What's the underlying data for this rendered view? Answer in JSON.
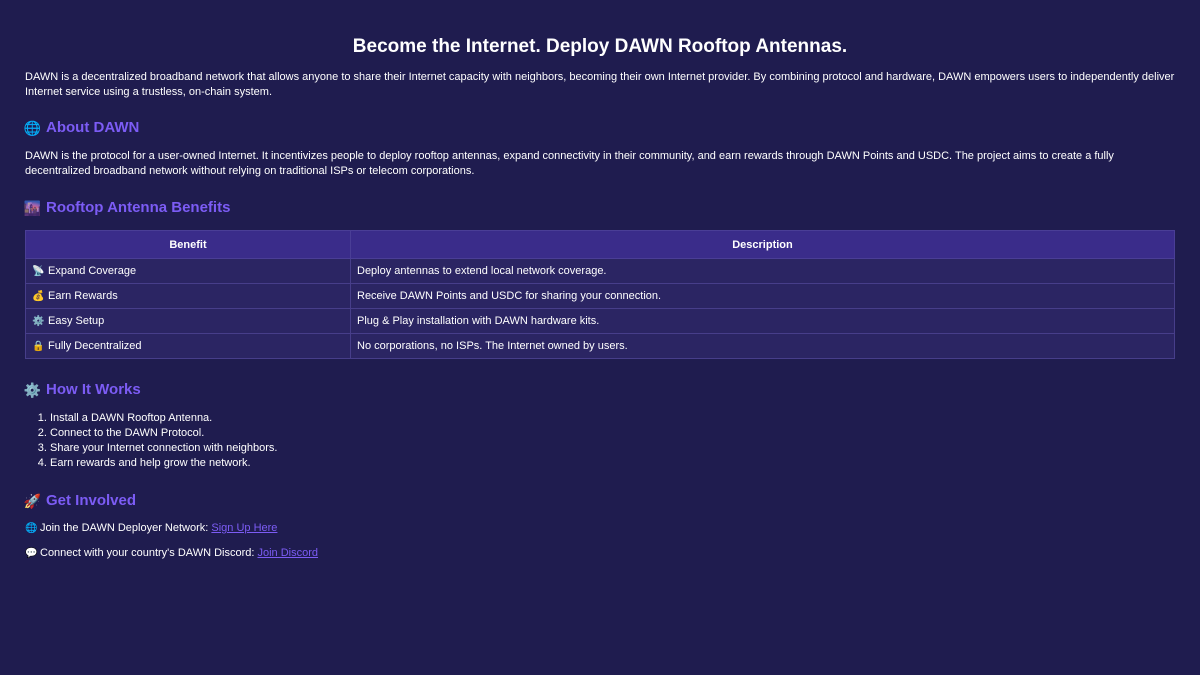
{
  "header": {
    "title": "Become the Internet. Deploy DAWN Rooftop Antennas.",
    "intro": "DAWN is a decentralized broadband network that allows anyone to share their Internet capacity with neighbors, becoming their own Internet provider. By combining protocol and hardware, DAWN empowers users to independently deliver Internet service using a trustless, on-chain system."
  },
  "about": {
    "icon": "🌐",
    "icon_name": "globe-icon",
    "heading": "About DAWN",
    "text": "DAWN is the protocol for a user-owned Internet. It incentivizes people to deploy rooftop antennas, expand connectivity in their community, and earn rewards through DAWN Points and USDC. The project aims to create a fully decentralized broadband network without relying on traditional ISPs or telecom corporations."
  },
  "benefits": {
    "icon": "🌆",
    "icon_name": "cityscape-icon",
    "heading": "Rooftop Antenna Benefits",
    "columns": [
      "Benefit",
      "Description"
    ],
    "rows": [
      {
        "icon": "📡",
        "icon_name": "satellite-antenna-icon",
        "benefit": "Expand Coverage",
        "description": "Deploy antennas to extend local network coverage."
      },
      {
        "icon": "💰",
        "icon_name": "money-bag-icon",
        "benefit": "Earn Rewards",
        "description": "Receive DAWN Points and USDC for sharing your connection."
      },
      {
        "icon": "⚙️",
        "icon_name": "gear-icon",
        "benefit": "Easy Setup",
        "description": "Plug & Play installation with DAWN hardware kits."
      },
      {
        "icon": "🔒",
        "icon_name": "lock-icon",
        "benefit": "Fully Decentralized",
        "description": "No corporations, no ISPs. The Internet owned by users."
      }
    ]
  },
  "how": {
    "icon": "⚙️",
    "icon_name": "gear-icon",
    "heading": "How It Works",
    "steps": [
      "Install a DAWN Rooftop Antenna.",
      "Connect to the DAWN Protocol.",
      "Share your Internet connection with neighbors.",
      "Earn rewards and help grow the network."
    ]
  },
  "involved": {
    "icon": "🚀",
    "icon_name": "rocket-icon",
    "heading": "Get Involved",
    "deployer": {
      "icon": "🌐",
      "text": "Join the DAWN Deployer Network: ",
      "link": "Sign Up Here"
    },
    "discord": {
      "icon": "💬",
      "text": "Connect with your country's DAWN Discord: ",
      "link": "Join Discord"
    }
  },
  "colors": {
    "background": "#1f1c4f",
    "heading_accent": "#7c5cf5",
    "table_header": "#3a2c8a",
    "table_row": "#2b2563"
  }
}
